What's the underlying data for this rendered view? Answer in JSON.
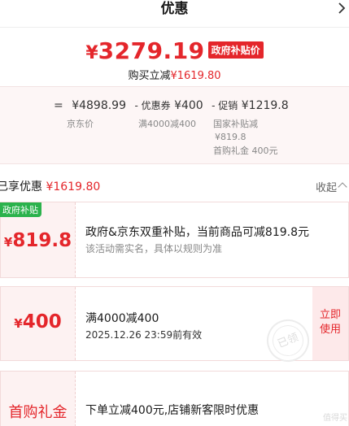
{
  "header": {
    "title": "优惠"
  },
  "price": {
    "currency": "¥",
    "amount": "3279.19",
    "badge": "政府补贴价"
  },
  "buy_line": {
    "label": "购买立减",
    "value": "¥1619.80"
  },
  "calc": {
    "eq": "=",
    "jd_price": "¥4898.99",
    "minus1": "- 优惠券",
    "coupon_val": "¥400",
    "minus2": "- 促销",
    "promo_val": "¥1219.8",
    "jd_label": "京东价",
    "coupon_label": "满4000减400",
    "promo_sub1": "国家补贴减",
    "promo_sub2": "¥819.8",
    "promo_sub3": "首购礼金 400元"
  },
  "summary": {
    "label": "已享优惠",
    "value": "¥1619.80",
    "collapse": "收起"
  },
  "coupons": [
    {
      "tag": "政府补贴",
      "currency": "¥",
      "amount": "819.8",
      "desc": "政府&京东双重补贴，当前商品可减819.8元",
      "sub": "该活动需实名，具体以规则为准"
    },
    {
      "currency": "¥",
      "amount": "400",
      "desc": "满4000减400",
      "sub": "2025.12.26 23:59前有效",
      "action_line1": "立即",
      "action_line2": "使用",
      "stamp": "已领"
    },
    {
      "amount_text": "首购礼金",
      "desc": "下单立减400元,店铺新客限时优惠"
    }
  ],
  "watermark": "值得买",
  "colors": {
    "accent": "#e4262b",
    "green_tag": "#2bb24c",
    "pink_bg": "#fdf2f2"
  }
}
